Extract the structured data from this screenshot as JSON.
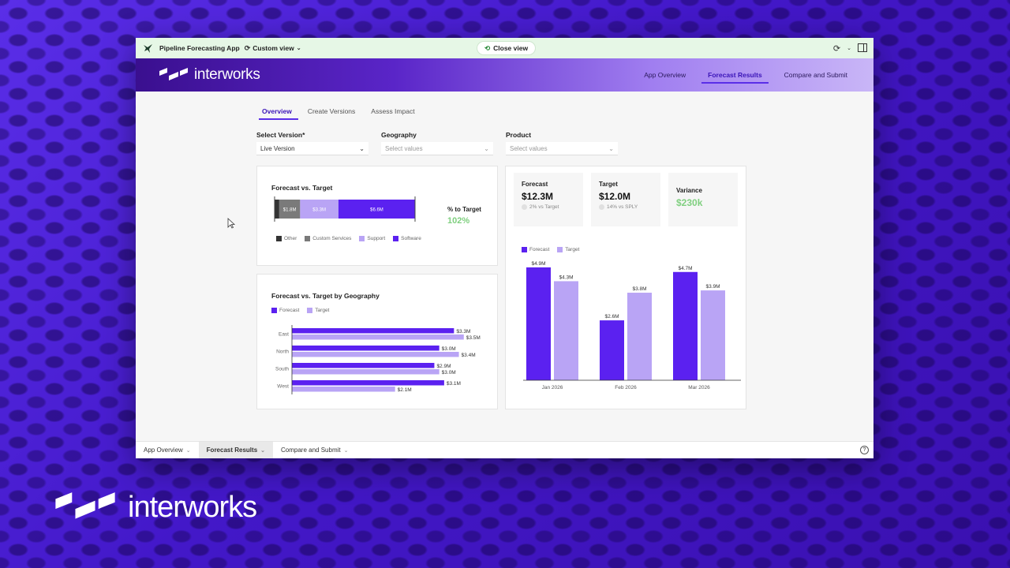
{
  "titlebar": {
    "app_name": "Pipeline Forecasting App",
    "view_label": "Custom view",
    "close_view_label": "Close view"
  },
  "header": {
    "brand": "interworks",
    "nav": [
      {
        "label": "App Overview",
        "active": false
      },
      {
        "label": "Forecast Results",
        "active": true
      },
      {
        "label": "Compare and Submit",
        "active": false
      }
    ]
  },
  "subtabs": [
    {
      "label": "Overview",
      "active": true
    },
    {
      "label": "Create Versions",
      "active": false
    },
    {
      "label": "Assess Impact",
      "active": false
    }
  ],
  "filters": {
    "version": {
      "label": "Select Version*",
      "value": "Live Version"
    },
    "geography": {
      "label": "Geography",
      "placeholder": "Select values"
    },
    "product": {
      "label": "Product",
      "placeholder": "Select values"
    }
  },
  "colors": {
    "forecast": "#5b21f0",
    "target": "#b9a4f5",
    "other": "#333333",
    "custom_services": "#7a7a7a",
    "support": "#b9a4f5",
    "software": "#5b21f0",
    "green": "#7fcf7f"
  },
  "forecast_vs_target": {
    "title": "Forecast vs. Target",
    "pct_label": "% to Target",
    "pct_value": "102%",
    "segments": [
      {
        "name": "Other",
        "value": 0.4,
        "label": ""
      },
      {
        "name": "Custom Services",
        "value": 1.8,
        "label": "$1.8M"
      },
      {
        "name": "Support",
        "value": 3.3,
        "label": "$3.3M"
      },
      {
        "name": "Software",
        "value": 6.6,
        "label": "$6.6M"
      }
    ],
    "legend": [
      "Other",
      "Custom Services",
      "Support",
      "Software"
    ]
  },
  "kpis": {
    "forecast": {
      "label": "Forecast",
      "value": "$12.3M",
      "sub": "2% vs Target"
    },
    "target": {
      "label": "Target",
      "value": "$12.0M",
      "sub": "14% vs SPLY"
    },
    "variance": {
      "label": "Variance",
      "value": "$230k"
    }
  },
  "geo_chart": {
    "title": "Forecast vs. Target by Geography",
    "legend": [
      "Forecast",
      "Target"
    ],
    "chart_data": {
      "type": "bar",
      "orientation": "horizontal",
      "categories": [
        "East",
        "North",
        "South",
        "West"
      ],
      "series": [
        {
          "name": "Forecast",
          "values": [
            3.3,
            3.0,
            2.9,
            3.1
          ],
          "labels": [
            "$3.3M",
            "$3.0M",
            "$2.9M",
            "$3.1M"
          ]
        },
        {
          "name": "Target",
          "values": [
            3.5,
            3.4,
            3.0,
            2.1
          ],
          "labels": [
            "$3.5M",
            "$3.4M",
            "$3.0M",
            "$2.1M"
          ]
        }
      ],
      "xlim": [
        0,
        3.6
      ]
    }
  },
  "month_chart": {
    "legend": [
      "Forecast",
      "Target"
    ],
    "chart_data": {
      "type": "bar",
      "categories": [
        "Jan 2026",
        "Feb 2026",
        "Mar 2026"
      ],
      "series": [
        {
          "name": "Forecast",
          "values": [
            4.9,
            2.6,
            4.7
          ],
          "labels": [
            "$4.9M",
            "$2.6M",
            "$4.7M"
          ]
        },
        {
          "name": "Target",
          "values": [
            4.3,
            3.8,
            3.9
          ],
          "labels": [
            "$4.3M",
            "$3.8M",
            "$3.9M"
          ]
        }
      ],
      "ylim": [
        0,
        5.0
      ]
    }
  },
  "footer": {
    "tabs": [
      {
        "label": "App Overview",
        "active": false
      },
      {
        "label": "Forecast Results",
        "active": true
      },
      {
        "label": "Compare and Submit",
        "active": false
      }
    ],
    "help": "?"
  },
  "overlay_brand": "interworks"
}
